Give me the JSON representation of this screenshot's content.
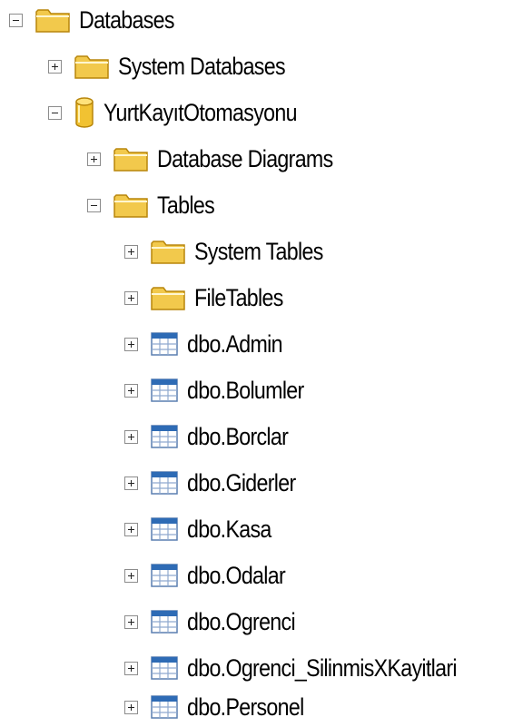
{
  "tree": {
    "databases": "Databases",
    "system_databases": "System Databases",
    "database_name": "YurtKayıtOtomasyonu",
    "database_diagrams": "Database Diagrams",
    "tables": "Tables",
    "system_tables": "System Tables",
    "file_tables": "FileTables",
    "table_items": [
      "dbo.Admin",
      "dbo.Bolumler",
      "dbo.Borclar",
      "dbo.Giderler",
      "dbo.Kasa",
      "dbo.Odalar",
      "dbo.Ogrenci",
      "dbo.Ogrenci_SilinmisXKayitlari",
      "dbo.Personel"
    ]
  },
  "icons": {
    "folder": "folder-icon",
    "database": "database-cylinder-icon",
    "table": "table-icon"
  },
  "colors": {
    "folder_fill": "#f2c94c",
    "database_fill": "#f1c232",
    "table_header": "#2e6bb5"
  }
}
